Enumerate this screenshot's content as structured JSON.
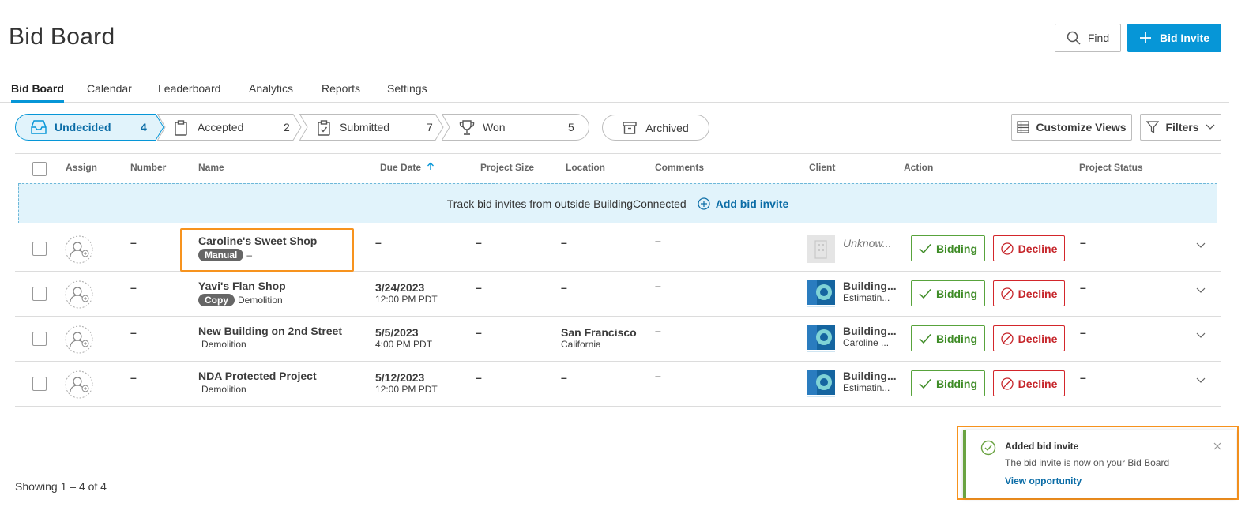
{
  "page": {
    "title": "Bid Board"
  },
  "header": {
    "find_label": "Find",
    "bid_invite_label": "Bid Invite"
  },
  "tabs": [
    {
      "label": "Bid Board",
      "active": true
    },
    {
      "label": "Calendar"
    },
    {
      "label": "Leaderboard"
    },
    {
      "label": "Analytics"
    },
    {
      "label": "Reports"
    },
    {
      "label": "Settings"
    }
  ],
  "stages": [
    {
      "label": "Undecided",
      "count": "4",
      "icon": "inbox-icon",
      "active": true
    },
    {
      "label": "Accepted",
      "count": "2",
      "icon": "clipboard-icon"
    },
    {
      "label": "Submitted",
      "count": "7",
      "icon": "clipboard-check-icon"
    },
    {
      "label": "Won",
      "count": "5",
      "icon": "trophy-icon"
    }
  ],
  "archived_label": "Archived",
  "toolbar": {
    "customize_label": "Customize Views",
    "filters_label": "Filters"
  },
  "columns": [
    "Assign",
    "Number",
    "Name",
    "Due Date",
    "Project Size",
    "Location",
    "Comments",
    "Client",
    "Action",
    "Project Status"
  ],
  "banner": {
    "text": "Track bid invites from outside BuildingConnected",
    "link": "Add bid invite"
  },
  "rows": [
    {
      "number": "–",
      "name": "Caroline's Sweet Shop",
      "badge": "Manual",
      "trade": "–",
      "due_date": "–",
      "due_time": "",
      "size": "–",
      "location": "–",
      "location_sub": "",
      "comments": "–",
      "client": "Unknow...",
      "client_sub": "",
      "client_unknown": true,
      "bidding_label": "Bidding",
      "decline_label": "Decline",
      "status": "–"
    },
    {
      "number": "–",
      "name": "Yavi's Flan Shop",
      "badge": "Copy",
      "trade": "Demolition",
      "due_date": "3/24/2023",
      "due_time": "12:00 PM PDT",
      "size": "–",
      "location": "–",
      "location_sub": "",
      "comments": "–",
      "client": "Building...",
      "client_sub": "Estimatin...",
      "client_unknown": false,
      "bidding_label": "Bidding",
      "decline_label": "Decline",
      "status": "–"
    },
    {
      "number": "–",
      "name": "New Building on 2nd Street",
      "badge": "",
      "trade": "Demolition",
      "due_date": "5/5/2023",
      "due_time": "4:00 PM PDT",
      "size": "–",
      "location": "San Francisco",
      "location_sub": "California",
      "comments": "–",
      "client": "Building...",
      "client_sub": "Caroline ...",
      "client_unknown": false,
      "bidding_label": "Bidding",
      "decline_label": "Decline",
      "status": "–"
    },
    {
      "number": "–",
      "name": "NDA Protected Project",
      "badge": "",
      "trade": "Demolition",
      "due_date": "5/12/2023",
      "due_time": "12:00 PM PDT",
      "size": "–",
      "location": "–",
      "location_sub": "",
      "comments": "–",
      "client": "Building...",
      "client_sub": "Estimatin...",
      "client_unknown": false,
      "bidding_label": "Bidding",
      "decline_label": "Decline",
      "status": "–"
    }
  ],
  "footer": {
    "showing": "Showing 1 – 4 of 4"
  },
  "toast": {
    "title": "Added bid invite",
    "message": "The bid invite is now on your Bid Board",
    "link": "View opportunity"
  },
  "colors": {
    "accent": "#0696d7",
    "success": "#6aa341",
    "danger": "#d3262b",
    "highlight": "#f7931e"
  }
}
